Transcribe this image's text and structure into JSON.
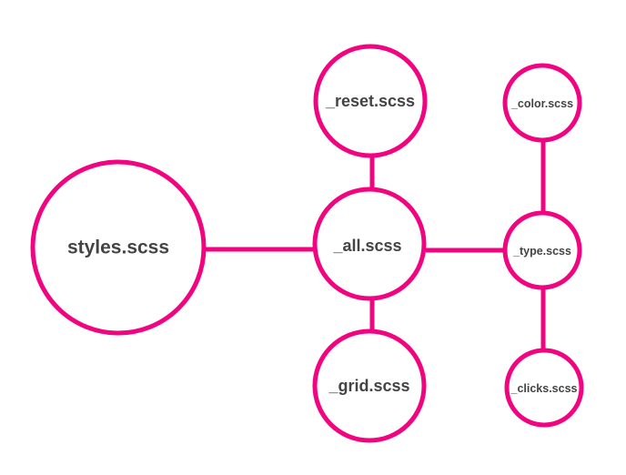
{
  "colors": {
    "accent": "#f0047f",
    "label": "#444444",
    "background": "#ffffff"
  },
  "nodes": {
    "styles": {
      "label": "styles.scss"
    },
    "all": {
      "label": "_all.scss"
    },
    "reset": {
      "label": "_reset.scss"
    },
    "grid": {
      "label": "_grid.scss"
    },
    "type": {
      "label": "_type.scss"
    },
    "color": {
      "label": "_color.scss"
    },
    "clicks": {
      "label": "_clicks.scss"
    }
  },
  "edges": [
    {
      "from": "styles",
      "to": "all"
    },
    {
      "from": "reset",
      "to": "all"
    },
    {
      "from": "all",
      "to": "grid"
    },
    {
      "from": "all",
      "to": "type"
    },
    {
      "from": "color",
      "to": "type"
    },
    {
      "from": "type",
      "to": "clicks"
    }
  ]
}
